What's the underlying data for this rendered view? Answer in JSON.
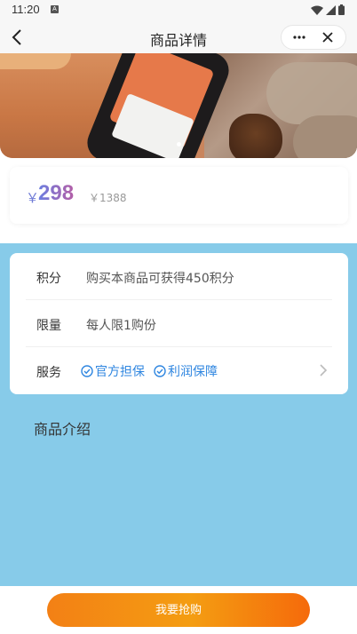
{
  "status_bar": {
    "time": "11:20",
    "notification_glyph": "A"
  },
  "nav": {
    "title": "商品详情",
    "back_icon": "chevron-left-icon",
    "more_icon": "more-dots-icon",
    "close_icon": "close-icon"
  },
  "banner": {
    "slide_count": 1,
    "active_index": 0
  },
  "price": {
    "currency": "￥",
    "current": "298",
    "original": "￥1388"
  },
  "info": {
    "points_label": "积分",
    "points_value": "购买本商品可获得450积分",
    "limit_label": "限量",
    "limit_value": "每人限1购份",
    "service_label": "服务",
    "services": [
      "官方担保",
      "利润保障"
    ]
  },
  "intro": {
    "title": "商品介绍"
  },
  "bottom": {
    "buy_label": "我要抢购"
  },
  "colors": {
    "accent_blue": "#2f86e0",
    "page_blue": "#87cbe9",
    "buy_orange": "#f49d12"
  }
}
